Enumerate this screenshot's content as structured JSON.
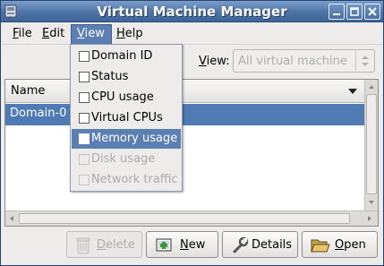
{
  "window": {
    "title": "Virtual Machine Manager"
  },
  "menubar": {
    "items": [
      {
        "label": "File",
        "mnemonic": "F",
        "rest": "ile"
      },
      {
        "label": "Edit",
        "mnemonic": "E",
        "rest": "dit"
      },
      {
        "label": "View",
        "mnemonic": "V",
        "rest": "iew"
      },
      {
        "label": "Help",
        "mnemonic": "H",
        "rest": "elp"
      }
    ]
  },
  "view_menu": {
    "items": [
      {
        "label": "Domain ID",
        "checked": false,
        "enabled": true
      },
      {
        "label": "Status",
        "checked": false,
        "enabled": true
      },
      {
        "label": "CPU usage",
        "checked": false,
        "enabled": true
      },
      {
        "label": "Virtual CPUs",
        "checked": false,
        "enabled": true
      },
      {
        "label": "Memory usage",
        "checked": false,
        "enabled": true,
        "highlighted": true
      },
      {
        "label": "Disk usage",
        "checked": false,
        "enabled": false
      },
      {
        "label": "Network traffic",
        "checked": false,
        "enabled": false
      }
    ]
  },
  "filter": {
    "label_mnemonic": "V",
    "label_rest": "iew:",
    "value": "All virtual machine"
  },
  "list": {
    "column_header": "Name",
    "rows": [
      {
        "name": "Domain-0",
        "selected": true
      }
    ]
  },
  "buttons": {
    "delete": {
      "mnemonic": "D",
      "rest": "elete",
      "enabled": false,
      "icon": "trash-icon"
    },
    "new": {
      "mnemonic": "N",
      "rest": "ew",
      "enabled": true,
      "icon": "new-vm-icon"
    },
    "details": {
      "label": "Details",
      "enabled": true,
      "icon": "wrench-icon"
    },
    "open": {
      "mnemonic": "O",
      "rest": "pen",
      "enabled": true,
      "icon": "folder-open-icon"
    }
  },
  "colors": {
    "titlebar": "#4e73a6",
    "selection": "#4f7ab3",
    "menu_highlight": "#5b7fb3"
  }
}
